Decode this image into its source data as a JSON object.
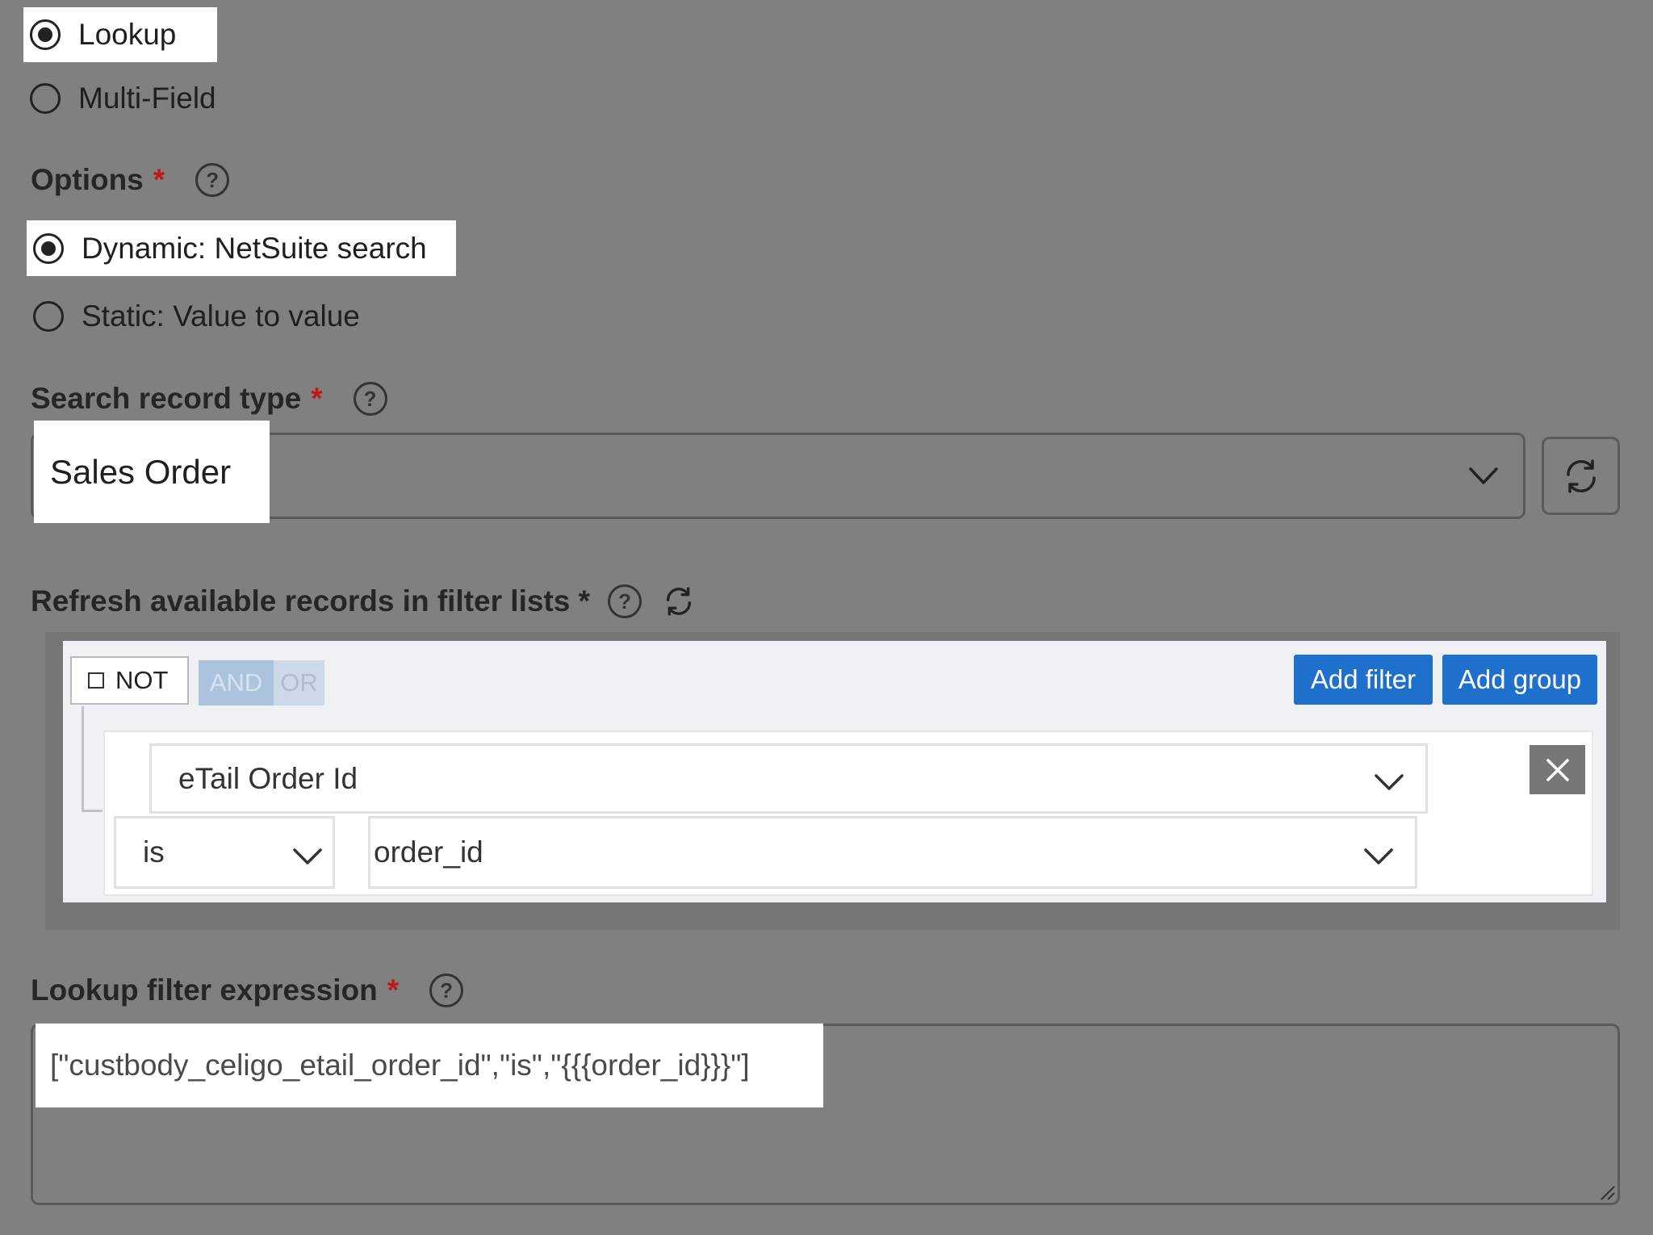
{
  "lookup_type": {
    "options": [
      {
        "label": "Lookup",
        "checked": true
      },
      {
        "label": "Multi-Field",
        "checked": false
      }
    ]
  },
  "options_field": {
    "label": "Options",
    "required_mark": "*",
    "help_icon": "question-circle-icon",
    "choices": [
      {
        "label": "Dynamic: NetSuite search",
        "checked": true
      },
      {
        "label": "Static: Value to value",
        "checked": false
      }
    ]
  },
  "search_record_type": {
    "label": "Search record type",
    "required_mark": "*",
    "value": "Sales Order",
    "dropdown_icon": "chevron-down-icon",
    "refresh_icon": "refresh-icon"
  },
  "filter_lists": {
    "label": "Refresh available records in filter lists *",
    "help_icon": "question-circle-icon",
    "refresh_icon": "refresh-icon"
  },
  "filter_builder": {
    "not_label": "NOT",
    "and_label": "AND",
    "or_label": "OR",
    "add_filter_label": "Add filter",
    "add_group_label": "Add group",
    "rule": {
      "field": "eTail Order Id",
      "operator": "is",
      "value": "order_id",
      "delete_icon": "close-icon"
    }
  },
  "lookup_filter_expression": {
    "label": "Lookup filter expression",
    "required_mark": "*",
    "value": "[\"custbody_celigo_etail_order_id\",\"is\",\"{{{order_id}}}\"]"
  },
  "colors": {
    "background": "#808080",
    "required": "#c01818",
    "button_blue": "#1f6fcd"
  }
}
